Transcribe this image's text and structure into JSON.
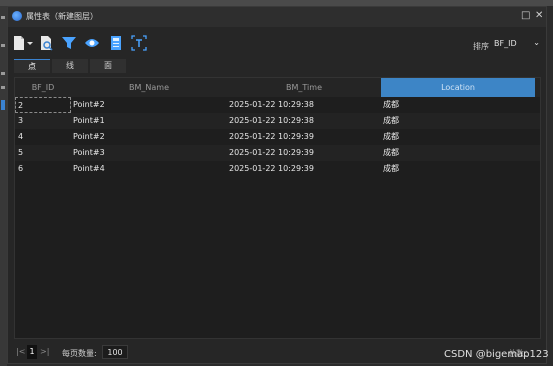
{
  "window": {
    "title": "属性表（新建图层）",
    "minimize_label": "□",
    "close_label": "✕"
  },
  "toolbar": {
    "buttons": [
      {
        "name": "document-dropdown",
        "icon": "document-icon"
      },
      {
        "name": "document-search",
        "icon": "document-search-icon"
      },
      {
        "name": "filter",
        "icon": "filter-icon"
      },
      {
        "name": "view",
        "icon": "eye-icon"
      },
      {
        "name": "calculator",
        "icon": "calculator-icon"
      },
      {
        "name": "text-field",
        "icon": "text-frame-icon"
      }
    ],
    "sort_label": "排序",
    "sort_value": "BF_ID"
  },
  "tabs": [
    {
      "label": "点",
      "active": true
    },
    {
      "label": "线",
      "active": false
    },
    {
      "label": "面",
      "active": false
    }
  ],
  "table": {
    "columns": [
      "BF_ID",
      "BM_Name",
      "BM_Time",
      "Location"
    ],
    "selected_column": "Location",
    "rows": [
      [
        "2",
        "Point#2",
        "2025-01-22 10:29:38",
        "成都"
      ],
      [
        "3",
        "Point#1",
        "2025-01-22 10:29:38",
        "成都"
      ],
      [
        "4",
        "Point#2",
        "2025-01-22 10:29:39",
        "成都"
      ],
      [
        "5",
        "Point#3",
        "2025-01-22 10:29:39",
        "成都"
      ],
      [
        "6",
        "Point#4",
        "2025-01-22 10:29:39",
        "成都"
      ]
    ]
  },
  "pagination": {
    "prev_label": "|<",
    "current_page": "1",
    "next_label": ">|",
    "page_size_label": "每页数量:",
    "page_size": "100",
    "info": "总数："
  },
  "watermark": "CSDN @bigemap123",
  "colors": {
    "accent": "#3d85c6",
    "background": "#262626",
    "grid": "#1e1e1e"
  }
}
